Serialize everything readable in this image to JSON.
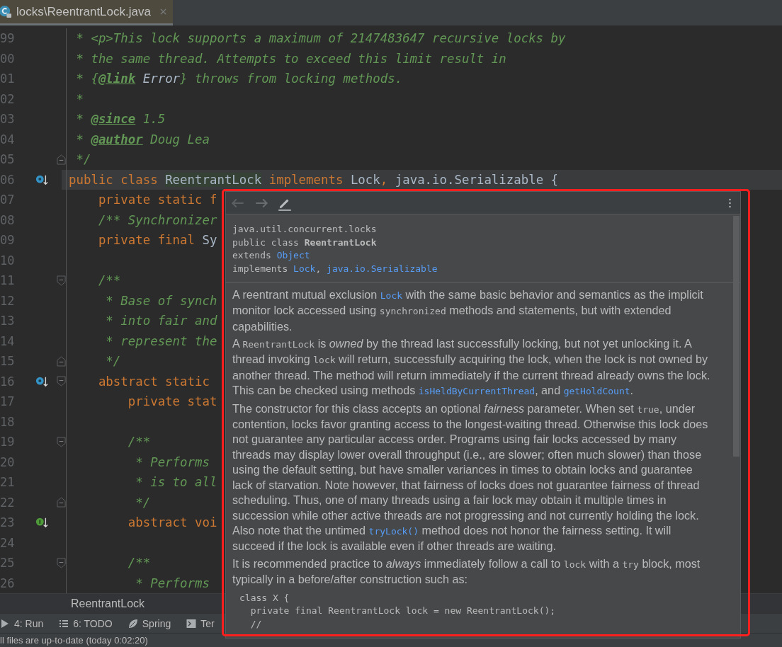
{
  "tab": {
    "label": "locks\\ReentrantLock.java",
    "selected": true
  },
  "editor": {
    "lines": [
      {
        "number": "99",
        "current": false,
        "segments": [
          {
            "text": " * <p>This lock supports a maximum of 2147483647 recursive locks by",
            "kind": "comment"
          }
        ]
      },
      {
        "number": "00",
        "current": false,
        "segments": [
          {
            "text": " * the same thread. Attempts to exceed this limit result in",
            "kind": "comment"
          }
        ]
      },
      {
        "number": "01",
        "current": false,
        "segments": [
          {
            "text": " * {",
            "kind": "comment"
          },
          {
            "text": "@link",
            "kind": "doctag"
          },
          {
            "text": " Error",
            "kind": "docref"
          },
          {
            "text": "} throws from locking methods.",
            "kind": "comment"
          }
        ]
      },
      {
        "number": "02",
        "current": false,
        "segments": [
          {
            "text": " *",
            "kind": "comment"
          }
        ]
      },
      {
        "number": "03",
        "current": false,
        "segments": [
          {
            "text": " * ",
            "kind": "comment"
          },
          {
            "text": "@since",
            "kind": "doctag"
          },
          {
            "text": " 1.5",
            "kind": "comment"
          }
        ]
      },
      {
        "number": "04",
        "current": false,
        "segments": [
          {
            "text": " * ",
            "kind": "comment"
          },
          {
            "text": "@author",
            "kind": "doctag"
          },
          {
            "text": " Doug Lea",
            "kind": "comment"
          }
        ]
      },
      {
        "number": "05",
        "current": false,
        "fold": {
          "kind": "end"
        },
        "segments": [
          {
            "text": " */",
            "kind": "comment"
          }
        ]
      },
      {
        "number": "06",
        "current": true,
        "gutter_icon": {
          "kind": "override"
        },
        "segments": [
          {
            "text": "public class ",
            "kind": "keyword"
          },
          {
            "text": "ReentrantLock",
            "kind": "match"
          },
          {
            "text": " implements ",
            "kind": "keyword"
          },
          {
            "text": "Lock",
            "kind": "plain"
          },
          {
            "text": ",",
            "kind": "keyword"
          },
          {
            "text": " java.io.Serializable {",
            "kind": "plain"
          }
        ]
      },
      {
        "number": "07",
        "current": false,
        "segments": [
          {
            "text": "    private static f",
            "kind": "keyword"
          }
        ]
      },
      {
        "number": "08",
        "current": false,
        "segments": [
          {
            "text": "    /** Synchronizer",
            "kind": "comment"
          }
        ]
      },
      {
        "number": "09",
        "current": false,
        "segments": [
          {
            "text": "    private final ",
            "kind": "keyword"
          },
          {
            "text": "Sy",
            "kind": "plain"
          }
        ]
      },
      {
        "number": "10",
        "current": false
      },
      {
        "number": "11",
        "current": false,
        "fold": {
          "kind": "start"
        },
        "segments": [
          {
            "text": "    /**",
            "kind": "comment"
          }
        ]
      },
      {
        "number": "12",
        "current": false,
        "segments": [
          {
            "text": "     * Base of synch",
            "kind": "comment"
          }
        ]
      },
      {
        "number": "13",
        "current": false,
        "segments": [
          {
            "text": "     * into fair and",
            "kind": "comment"
          }
        ]
      },
      {
        "number": "14",
        "current": false,
        "segments": [
          {
            "text": "     * represent the",
            "kind": "comment"
          }
        ]
      },
      {
        "number": "15",
        "current": false,
        "fold": {
          "kind": "end"
        },
        "segments": [
          {
            "text": "     */",
            "kind": "comment"
          }
        ]
      },
      {
        "number": "16",
        "current": false,
        "gutter_icon": {
          "kind": "override"
        },
        "fold": {
          "kind": "start"
        },
        "segments": [
          {
            "text": "    abstract static",
            "kind": "keyword"
          }
        ]
      },
      {
        "number": "17",
        "current": false,
        "segments": [
          {
            "text": "        private stat",
            "kind": "keyword"
          }
        ]
      },
      {
        "number": "18",
        "current": false
      },
      {
        "number": "19",
        "current": false,
        "fold": {
          "kind": "start"
        },
        "segments": [
          {
            "text": "        /**",
            "kind": "comment"
          }
        ]
      },
      {
        "number": "20",
        "current": false,
        "segments": [
          {
            "text": "         * Performs",
            "kind": "comment"
          }
        ]
      },
      {
        "number": "21",
        "current": false,
        "segments": [
          {
            "text": "         * is to all",
            "kind": "comment"
          }
        ]
      },
      {
        "number": "22",
        "current": false,
        "fold": {
          "kind": "end"
        },
        "segments": [
          {
            "text": "         */",
            "kind": "comment"
          }
        ]
      },
      {
        "number": "23",
        "current": false,
        "gutter_icon": {
          "kind": "implement"
        },
        "segments": [
          {
            "text": "        abstract voi",
            "kind": "keyword"
          }
        ]
      },
      {
        "number": "24",
        "current": false
      },
      {
        "number": "25",
        "current": false,
        "fold": {
          "kind": "start"
        },
        "segments": [
          {
            "text": "        /**",
            "kind": "comment"
          }
        ]
      },
      {
        "number": "26",
        "current": false,
        "segments": [
          {
            "text": "         * Performs",
            "kind": "comment"
          }
        ]
      }
    ]
  },
  "breadcrumb": "ReentrantLock",
  "tool_windows": [
    {
      "label": "4: Run",
      "kind": "run"
    },
    {
      "label": "6: TODO",
      "kind": "todo"
    },
    {
      "label": "Spring",
      "kind": "spring"
    },
    {
      "label": "Ter",
      "kind": "terminal"
    }
  ],
  "status_bar": "ll files are up-to-date (today 0:02:20)",
  "doc_popup": {
    "header": [
      [
        {
          "text": "java.util.concurrent.locks",
          "kind": "text"
        }
      ],
      [
        {
          "text": "public class ",
          "kind": "text"
        },
        {
          "text": "ReentrantLock",
          "kind": "bold"
        }
      ],
      [
        {
          "text": "extends ",
          "kind": "text"
        },
        {
          "text": "Object",
          "kind": "link"
        }
      ],
      [
        {
          "text": "implements ",
          "kind": "text"
        },
        {
          "text": "Lock",
          "kind": "link"
        },
        {
          "text": ", ",
          "kind": "text"
        },
        {
          "text": "java.io.Serializable",
          "kind": "link"
        }
      ]
    ],
    "paragraphs": [
      [
        {
          "text": "A reentrant mutual exclusion ",
          "kind": "text"
        },
        {
          "text": "Lock",
          "kind": "link"
        },
        {
          "text": " with the same basic behavior and semantics as the implicit monitor lock accessed using ",
          "kind": "text"
        },
        {
          "text": "synchronized",
          "kind": "code"
        },
        {
          "text": " methods and statements, but with extended capabilities.",
          "kind": "text"
        }
      ],
      [
        {
          "text": "A ",
          "kind": "text"
        },
        {
          "text": "ReentrantLock",
          "kind": "code"
        },
        {
          "text": " is ",
          "kind": "text"
        },
        {
          "text": "owned",
          "kind": "em"
        },
        {
          "text": " by the thread last successfully locking, but not yet unlocking it. A thread invoking ",
          "kind": "text"
        },
        {
          "text": "lock",
          "kind": "code"
        },
        {
          "text": " will return, successfully acquiring the lock, when the lock is not owned by another thread. The method will return immediately if the current thread already owns the lock. This can be checked using methods ",
          "kind": "text"
        },
        {
          "text": "isHeldByCurrentThread",
          "kind": "link"
        },
        {
          "text": ", and ",
          "kind": "text"
        },
        {
          "text": "getHoldCount",
          "kind": "link"
        },
        {
          "text": ".",
          "kind": "text"
        }
      ],
      [
        {
          "text": "The constructor for this class accepts an optional ",
          "kind": "text"
        },
        {
          "text": "fairness",
          "kind": "em"
        },
        {
          "text": " parameter. When set ",
          "kind": "text"
        },
        {
          "text": "true",
          "kind": "code"
        },
        {
          "text": ", under contention, locks favor granting access to the longest-waiting thread. Otherwise this lock does not guarantee any particular access order. Programs using fair locks accessed by many threads may display lower overall throughput (i.e., are slower; often much slower) than those using the default setting, but have smaller variances in times to obtain locks and guarantee lack of starvation. Note however, that fairness of locks does not guarantee fairness of thread scheduling. Thus, one of many threads using a fair lock may obtain it multiple times in succession while other active threads are not progressing and not currently holding the lock. Also note that the untimed ",
          "kind": "text"
        },
        {
          "text": "tryLock()",
          "kind": "link"
        },
        {
          "text": " method does not honor the fairness setting. It will succeed if the lock is available even if other threads are waiting.",
          "kind": "text"
        }
      ],
      [
        {
          "text": "It is recommended practice to ",
          "kind": "text"
        },
        {
          "text": "always",
          "kind": "em"
        },
        {
          "text": " immediately follow a call to ",
          "kind": "text"
        },
        {
          "text": "lock",
          "kind": "code"
        },
        {
          "text": " with a ",
          "kind": "text"
        },
        {
          "text": "try",
          "kind": "code"
        },
        {
          "text": " block, most typically in a before/after construction such as:",
          "kind": "text"
        }
      ]
    ],
    "code_example": [
      "class X {",
      "  private final ReentrantLock lock = new ReentrantLock();",
      "  //"
    ]
  }
}
